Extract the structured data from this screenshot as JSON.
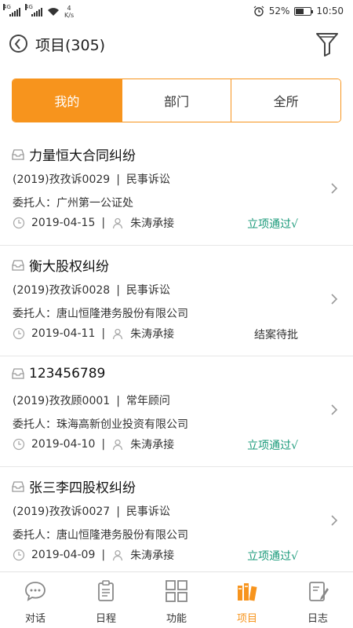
{
  "status_bar": {
    "sim1": "4G",
    "sim2": "4G",
    "speed_value": "4",
    "speed_unit": "K/s",
    "battery": "52%",
    "battery_level": 0.52,
    "time": "10:50"
  },
  "header": {
    "title": "项目(305)"
  },
  "segments": [
    {
      "label": "我的",
      "active": true
    },
    {
      "label": "部门",
      "active": false
    },
    {
      "label": "全所",
      "active": false
    }
  ],
  "items": [
    {
      "title": "力量恒大合同纠纷",
      "case_no": "(2019)孜孜诉0029",
      "case_type": "民事诉讼",
      "client": "委托人：广州第一公证处",
      "date": "2019-04-15",
      "handler": "朱涛承接",
      "status": "立项通过√",
      "status_kind": "ok"
    },
    {
      "title": "衡大股权纠纷",
      "case_no": "(2019)孜孜诉0028",
      "case_type": "民事诉讼",
      "client": "委托人：唐山恒隆港务股份有限公司",
      "date": "2019-04-11",
      "handler": "朱涛承接",
      "status": "结案待批",
      "status_kind": "pending"
    },
    {
      "title": "123456789",
      "case_no": "(2019)孜孜顾0001",
      "case_type": "常年顾问",
      "client": "委托人：珠海高新创业投资有限公司",
      "date": "2019-04-10",
      "handler": "朱涛承接",
      "status": "立项通过√",
      "status_kind": "ok"
    },
    {
      "title": "张三李四股权纠纷",
      "case_no": "(2019)孜孜诉0027",
      "case_type": "民事诉讼",
      "client": "委托人：唐山恒隆港务股份有限公司",
      "date": "2019-04-09",
      "handler": "朱涛承接",
      "status": "立项通过√",
      "status_kind": "ok"
    }
  ],
  "bottom_nav": [
    {
      "label": "对话",
      "icon": "chat-bubble-icon",
      "active": false
    },
    {
      "label": "日程",
      "icon": "clipboard-icon",
      "active": false
    },
    {
      "label": "功能",
      "icon": "grid-icon",
      "active": false
    },
    {
      "label": "项目",
      "icon": "folders-icon",
      "active": true
    },
    {
      "label": "日志",
      "icon": "notebook-pen-icon",
      "active": false
    }
  ],
  "colors": {
    "accent": "#f7941d",
    "status_ok": "#1a9a7a"
  }
}
